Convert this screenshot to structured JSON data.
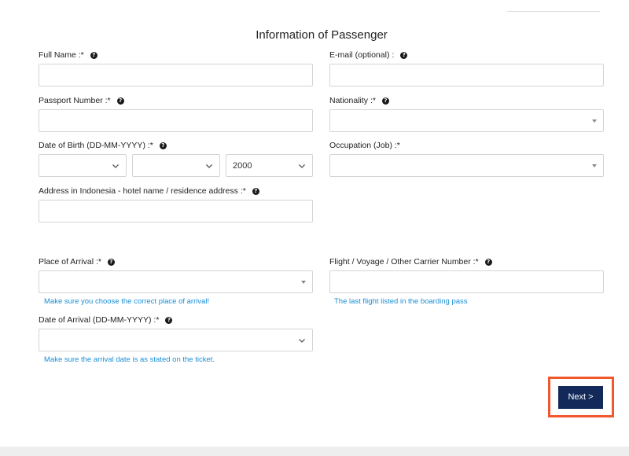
{
  "title": "Information of Passenger",
  "fields": {
    "full_name": {
      "label": "Full Name :*",
      "value": ""
    },
    "email": {
      "label": "E-mail (optional) :",
      "value": ""
    },
    "passport": {
      "label": "Passport Number :*",
      "value": ""
    },
    "nationality": {
      "label": "Nationality :*",
      "value": ""
    },
    "dob": {
      "label": "Date of Birth (DD-MM-YYYY) :*",
      "day": "",
      "month": "",
      "year": "2000"
    },
    "occupation": {
      "label": "Occupation (Job) :*",
      "value": ""
    },
    "address": {
      "label": "Address in Indonesia - hotel name / residence address :*",
      "value": ""
    },
    "place_of_arrival": {
      "label": "Place of Arrival :*",
      "value": "",
      "hint": "Make sure you choose the correct place of arrival!"
    },
    "flight": {
      "label": "Flight / Voyage / Other Carrier Number :*",
      "value": "",
      "hint": "The last flight listed in the boarding pass"
    },
    "date_of_arrival": {
      "label": "Date of Arrival (DD-MM-YYYY) :*",
      "value": "",
      "hint": "Make sure the arrival date is as stated on the ticket."
    }
  },
  "help_glyph": "?",
  "next_label": "Next >",
  "colors": {
    "accent": "#12295a",
    "highlight": "#f2582e",
    "hint": "#1a8fd6"
  },
  "icons": {
    "help": "question-circle-icon",
    "select": "chevron-down-icon",
    "combo": "caret-down-icon"
  }
}
